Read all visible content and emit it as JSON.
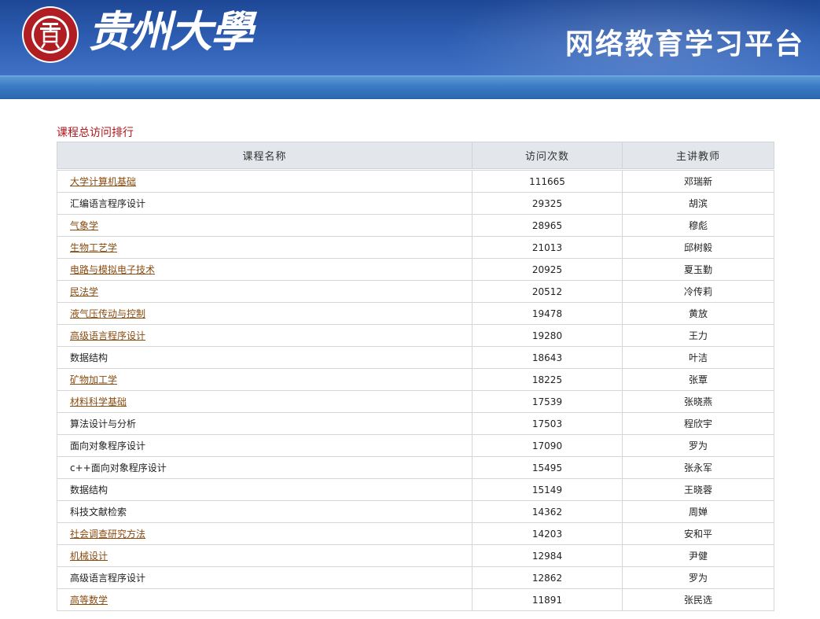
{
  "header": {
    "logo_text": "贵州大學",
    "platform_title": "网络教育学习平台",
    "seal_colors": {
      "ring": "#b01e23",
      "inner": "#ffffff"
    }
  },
  "section_title": "课程总访问排行",
  "table": {
    "columns": [
      "课程名称",
      "访问次数",
      "主讲教师"
    ],
    "rows": [
      {
        "course": "大学计算机基础",
        "visits": "111665",
        "teacher": "邓瑞新",
        "link": true
      },
      {
        "course": "汇编语言程序设计",
        "visits": "29325",
        "teacher": "胡滨",
        "link": false
      },
      {
        "course": "气象学",
        "visits": "28965",
        "teacher": "穆彪",
        "link": true
      },
      {
        "course": "生物工艺学",
        "visits": "21013",
        "teacher": "邱树毅",
        "link": true
      },
      {
        "course": "电路与模拟电子技术",
        "visits": "20925",
        "teacher": "夏玉勤",
        "link": true
      },
      {
        "course": "民法学",
        "visits": "20512",
        "teacher": "冷传莉",
        "link": true
      },
      {
        "course": "液气压传动与控制",
        "visits": "19478",
        "teacher": "黄放",
        "link": true
      },
      {
        "course": "高级语言程序设计",
        "visits": "19280",
        "teacher": "王力",
        "link": true
      },
      {
        "course": "数据结构",
        "visits": "18643",
        "teacher": "叶洁",
        "link": false
      },
      {
        "course": "矿物加工学",
        "visits": "18225",
        "teacher": "张覃",
        "link": true
      },
      {
        "course": "材料科学基础",
        "visits": "17539",
        "teacher": "张晓燕",
        "link": true
      },
      {
        "course": "算法设计与分析",
        "visits": "17503",
        "teacher": "程欣宇",
        "link": false
      },
      {
        "course": "面向对象程序设计",
        "visits": "17090",
        "teacher": "罗为",
        "link": false
      },
      {
        "course": "c++面向对象程序设计",
        "visits": "15495",
        "teacher": "张永军",
        "link": false
      },
      {
        "course": "数据结构",
        "visits": "15149",
        "teacher": "王晓蓉",
        "link": false
      },
      {
        "course": "科技文献检索",
        "visits": "14362",
        "teacher": "周婵",
        "link": false
      },
      {
        "course": "社会调查研究方法",
        "visits": "14203",
        "teacher": "安和平",
        "link": true
      },
      {
        "course": "机械设计",
        "visits": "12984",
        "teacher": "尹健",
        "link": true
      },
      {
        "course": "高级语言程序设计",
        "visits": "12862",
        "teacher": "罗为",
        "link": false
      },
      {
        "course": "高等数学",
        "visits": "11891",
        "teacher": "张民选",
        "link": true
      }
    ]
  }
}
